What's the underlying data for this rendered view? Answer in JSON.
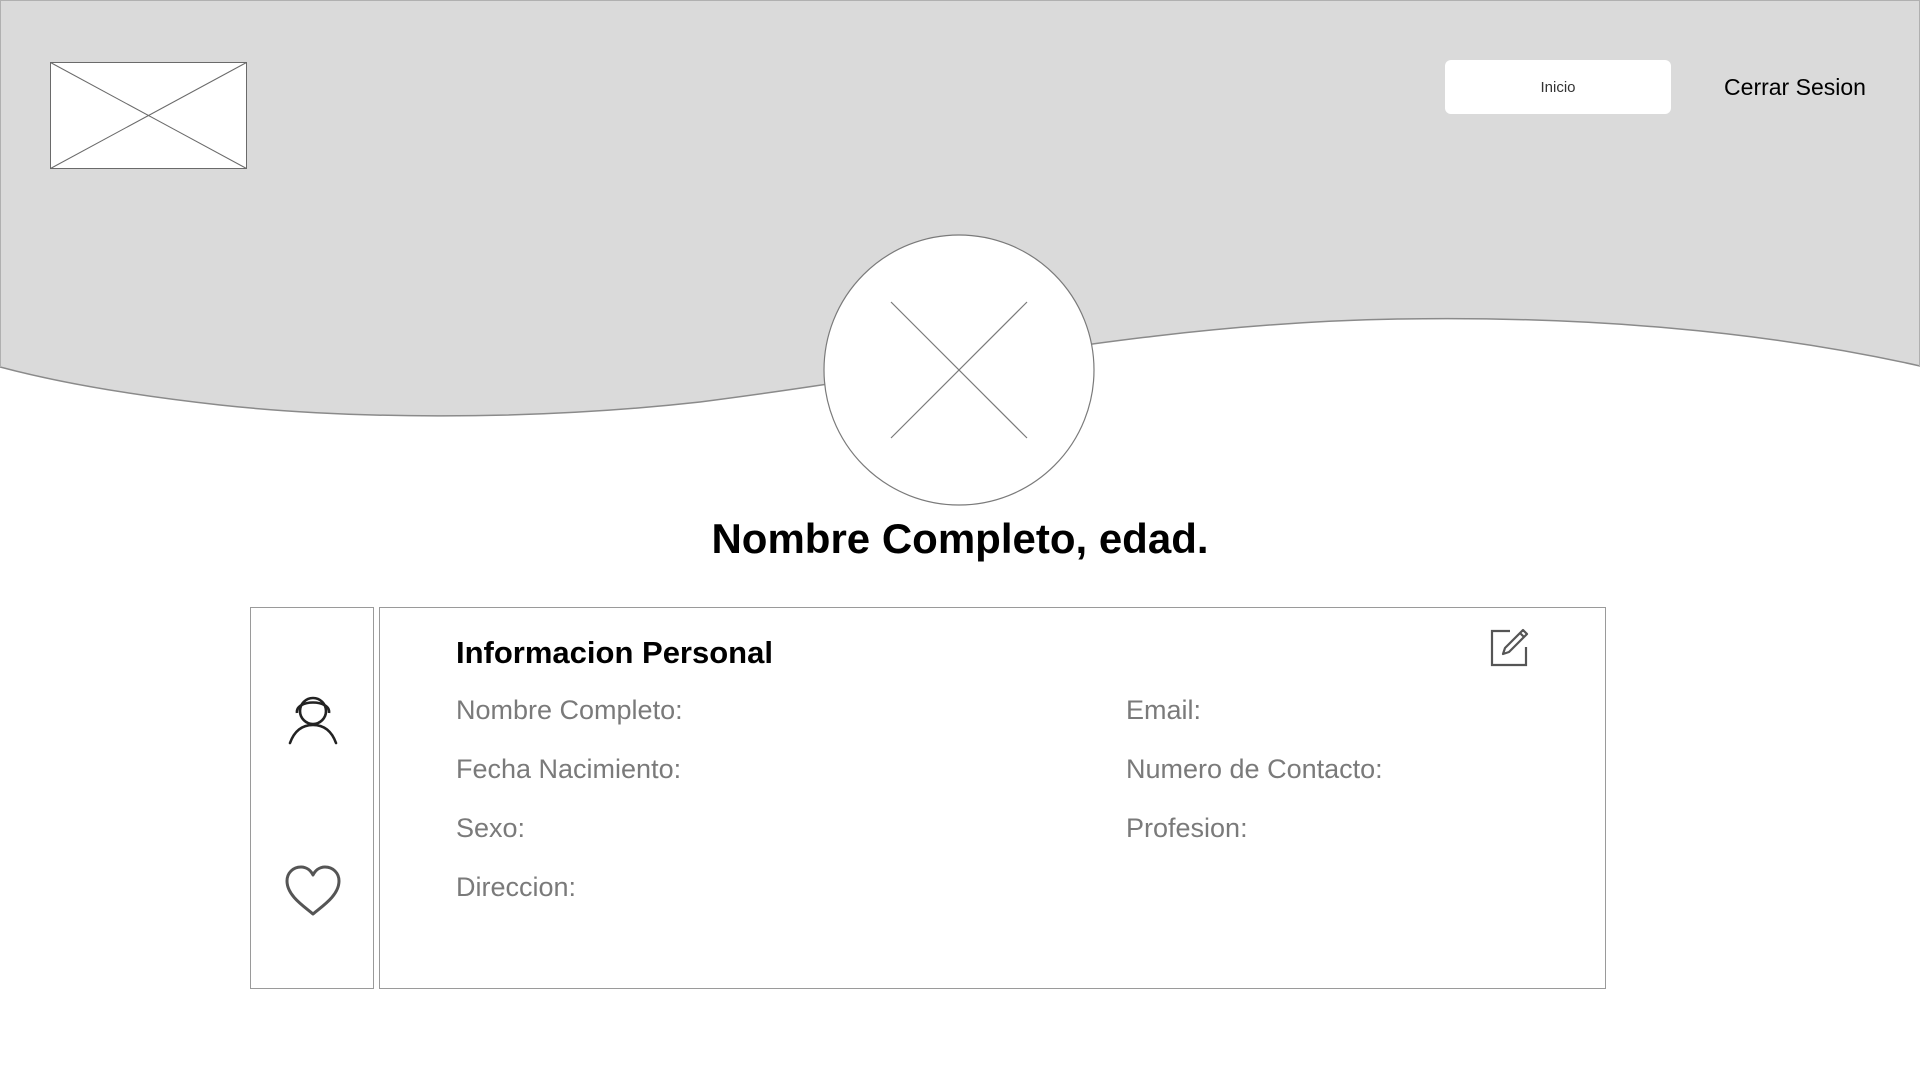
{
  "header": {
    "logo_icon": "image-placeholder-icon",
    "nav_home_label": "Inicio",
    "logout_label": "Cerrar Sesion",
    "background_color": "#dadada"
  },
  "profile": {
    "avatar_icon": "image-placeholder-icon",
    "name_age": "Nombre Completo, edad."
  },
  "sidebar": {
    "items": [
      {
        "icon": "user-icon"
      },
      {
        "icon": "heart-icon"
      }
    ]
  },
  "personal_info": {
    "title": "Informacion Personal",
    "edit_icon": "edit-icon",
    "fields_left": [
      "Nombre Completo:",
      "Fecha Nacimiento:",
      "Sexo:",
      "Direccion:"
    ],
    "fields_right": [
      "Email:",
      "Numero de Contacto:",
      "Profesion:"
    ]
  }
}
